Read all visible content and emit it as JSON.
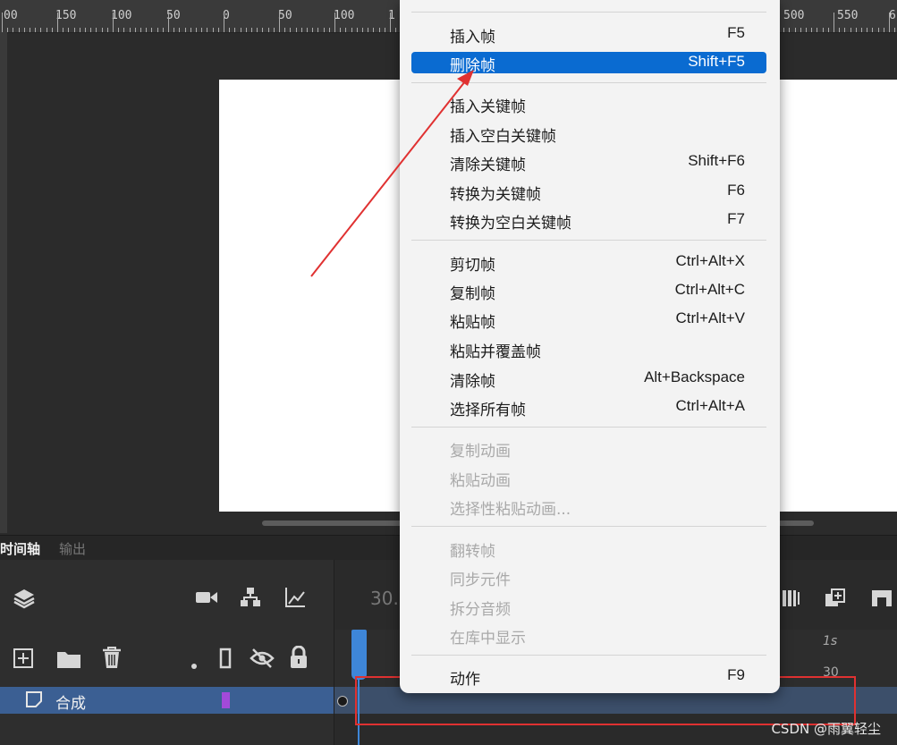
{
  "ruler": {
    "labels": [
      "00",
      "150",
      "100",
      "50",
      "0",
      "50",
      "100",
      "1",
      "500",
      "550",
      "6"
    ]
  },
  "timeline": {
    "tab_active": "时间轴",
    "tab_output": "输出",
    "fps_partial": "30.",
    "frame_label_1s": "1s",
    "frame_label_30": "30",
    "layer_name": "合成"
  },
  "menu": {
    "items": [
      {
        "label": "插入帧",
        "shortcut": "F5"
      },
      {
        "label": "删除帧",
        "shortcut": "Shift+F5",
        "highlighted": true
      },
      {
        "label": "插入关键帧",
        "shortcut": ""
      },
      {
        "label": "插入空白关键帧",
        "shortcut": ""
      },
      {
        "label": "清除关键帧",
        "shortcut": "Shift+F6"
      },
      {
        "label": "转换为关键帧",
        "shortcut": "F6"
      },
      {
        "label": "转换为空白关键帧",
        "shortcut": "F7"
      },
      {
        "label": "剪切帧",
        "shortcut": "Ctrl+Alt+X"
      },
      {
        "label": "复制帧",
        "shortcut": "Ctrl+Alt+C"
      },
      {
        "label": "粘贴帧",
        "shortcut": "Ctrl+Alt+V"
      },
      {
        "label": "粘贴并覆盖帧",
        "shortcut": ""
      },
      {
        "label": "清除帧",
        "shortcut": "Alt+Backspace"
      },
      {
        "label": "选择所有帧",
        "shortcut": "Ctrl+Alt+A"
      },
      {
        "label": "复制动画",
        "shortcut": "",
        "disabled": true
      },
      {
        "label": "粘贴动画",
        "shortcut": "",
        "disabled": true
      },
      {
        "label": "选择性粘贴动画...",
        "shortcut": "",
        "disabled": true
      },
      {
        "label": "翻转帧",
        "shortcut": "",
        "disabled": true
      },
      {
        "label": "同步元件",
        "shortcut": "",
        "disabled": true
      },
      {
        "label": "拆分音频",
        "shortcut": "",
        "disabled": true
      },
      {
        "label": "在库中显示",
        "shortcut": "",
        "disabled": true
      },
      {
        "label": "动作",
        "shortcut": "F9"
      }
    ]
  },
  "icons": {
    "layers": "layers-icon",
    "camera": "camera-icon",
    "hierarchy": "hierarchy-icon",
    "graph": "graph-icon",
    "add_layer": "add-layer-icon",
    "folder": "folder-icon",
    "trash": "trash-icon",
    "dot": "dot-icon",
    "outline": "outline-icon",
    "hide": "eye-hidden-icon",
    "lock": "lock-icon",
    "layer_type": "layer-icon"
  },
  "colors": {
    "highlight": "#0a6bd1",
    "annotation_red": "#e03131",
    "layer_row": "#3b5f93",
    "playhead": "#3e86d8"
  },
  "watermark": "CSDN @雨翼轻尘"
}
